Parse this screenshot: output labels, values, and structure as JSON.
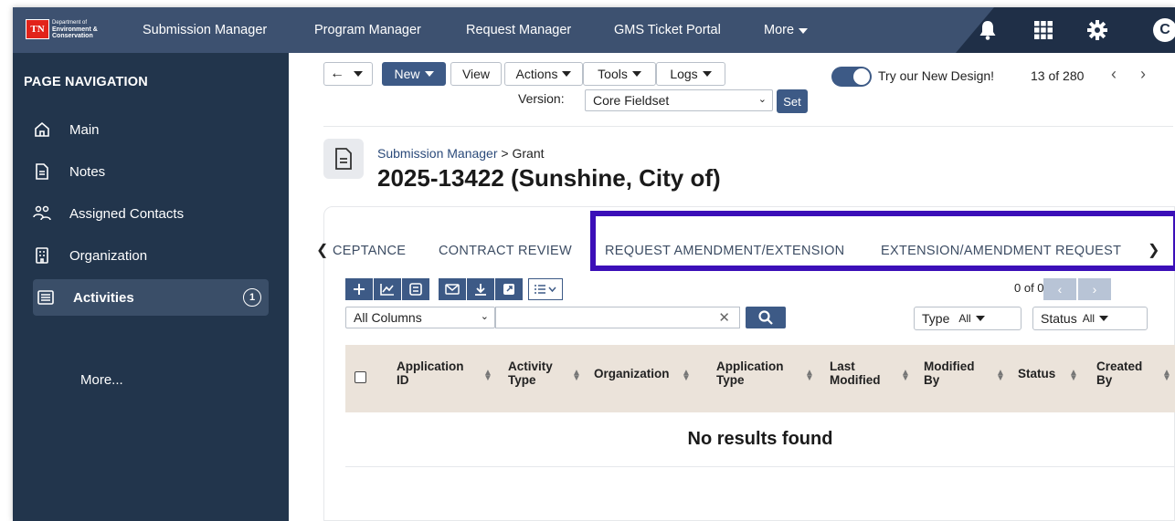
{
  "header": {
    "logo": {
      "abbr": "TN",
      "dept_line1": "Department of",
      "dept_line2": "Environment &",
      "dept_line3": "Conservation"
    },
    "nav": [
      "Submission Manager",
      "Program Manager",
      "Request Manager",
      "GMS Ticket Portal",
      "More"
    ],
    "icons": [
      "bell-icon",
      "grid-icon",
      "gear-icon"
    ],
    "avatar_letter": "C"
  },
  "sidebar": {
    "title": "PAGE NAVIGATION",
    "items": [
      {
        "label": "Main",
        "icon": "home-icon"
      },
      {
        "label": "Notes",
        "icon": "note-icon"
      },
      {
        "label": "Assigned Contacts",
        "icon": "contacts-icon"
      },
      {
        "label": "Organization",
        "icon": "building-icon"
      },
      {
        "label": "Activities",
        "icon": "list-icon",
        "active": true,
        "badge": "1"
      }
    ],
    "more": "More..."
  },
  "toolbar": {
    "back": "←",
    "new": "New",
    "view": "View",
    "actions": "Actions",
    "tools": "Tools",
    "logs": "Logs",
    "version_label": "Version:",
    "version_value": "Core Fieldset",
    "set": "Set",
    "new_design": "Try our New Design!",
    "record_count": "13 of 280"
  },
  "record": {
    "breadcrumb_parent": "Submission Manager",
    "breadcrumb_sep": ">",
    "breadcrumb_current": "Grant",
    "title": "2025-13422 (Sunshine, City of)"
  },
  "tabs": [
    "CEPTANCE",
    "CONTRACT REVIEW",
    "REQUEST AMENDMENT/EXTENSION",
    "EXTENSION/AMENDMENT REQUEST"
  ],
  "grid": {
    "pager": "0 of 0",
    "search_column": "All Columns",
    "search_value": "",
    "filters": [
      {
        "label": "Type",
        "value": "All"
      },
      {
        "label": "Status",
        "value": "All"
      }
    ],
    "columns": [
      {
        "l1": "Application",
        "l2": "ID"
      },
      {
        "l1": "Activity",
        "l2": "Type"
      },
      {
        "l1": "Organization",
        "l2": ""
      },
      {
        "l1": "Application",
        "l2": "Type"
      },
      {
        "l1": "Last",
        "l2": "Modified"
      },
      {
        "l1": "Modified",
        "l2": "By"
      },
      {
        "l1": "Status",
        "l2": ""
      },
      {
        "l1": "Created",
        "l2": "By"
      }
    ],
    "empty_text": "No results found"
  },
  "colors": {
    "topbar": "#3d5170",
    "sidebar": "#22354c",
    "accent": "#3d5a86",
    "highlight": "#3b0fb8",
    "table_header": "#ebe3da"
  }
}
